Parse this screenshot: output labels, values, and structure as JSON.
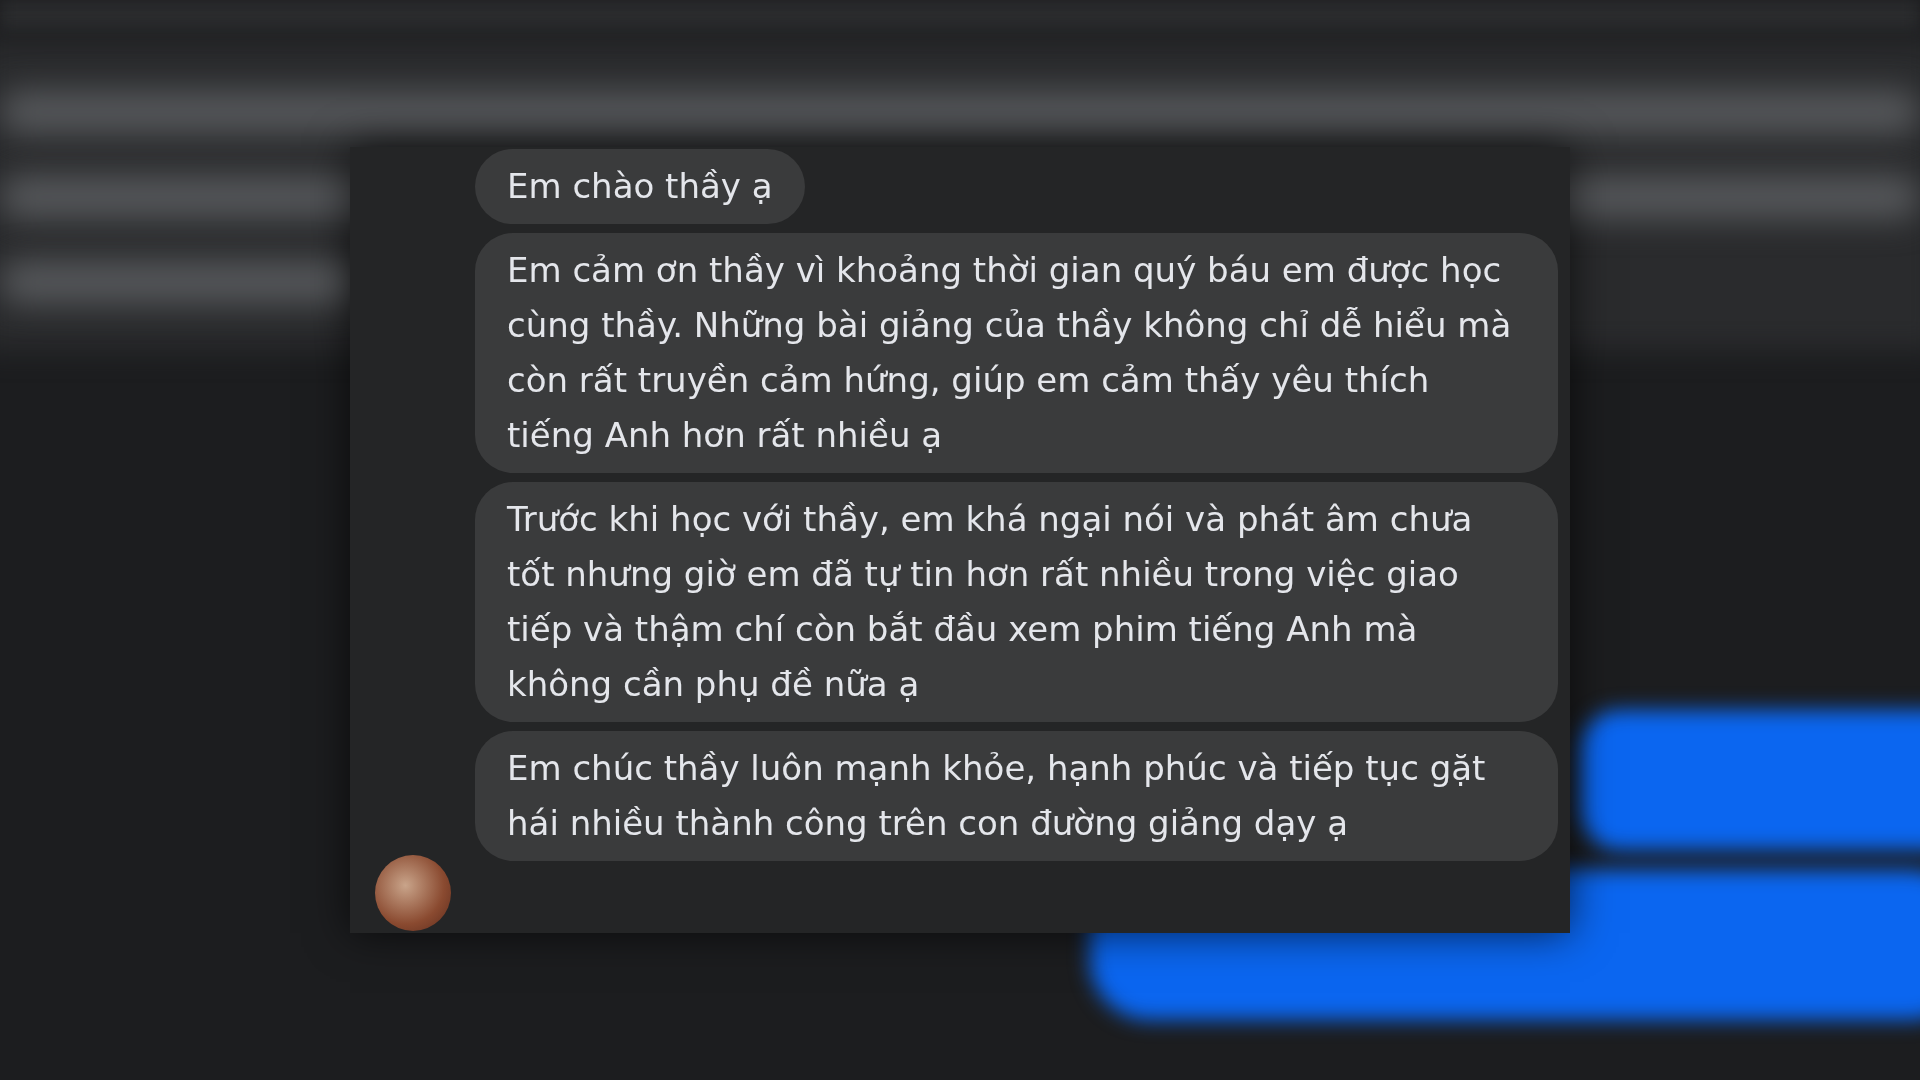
{
  "messages": [
    {
      "text": "Em chào thầy ạ"
    },
    {
      "text": "Em cảm ơn thầy vì khoảng thời gian quý báu em được học cùng thầy. Những bài giảng của thầy không chỉ dễ hiểu mà còn rất truyền cảm hứng, giúp em cảm thấy yêu thích tiếng Anh hơn rất nhiều ạ"
    },
    {
      "text": "Trước khi học với thầy, em khá ngại nói và phát âm chưa tốt nhưng giờ em đã tự tin hơn rất nhiều trong việc giao tiếp và thậm chí còn bắt đầu xem phim tiếng Anh mà không cần phụ đề nữa ạ"
    },
    {
      "text": "Em chúc thầy luôn mạnh khỏe, hạnh phúc và tiếp tục gặt hái nhiều thành công trên con đường giảng dạy ạ"
    }
  ]
}
